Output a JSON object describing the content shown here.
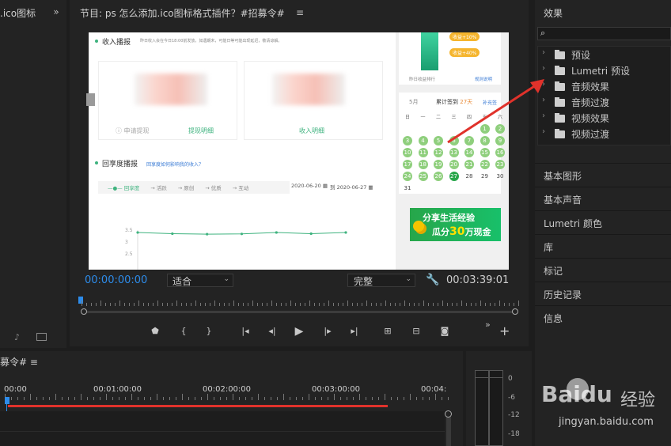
{
  "left_panel": {
    "tab_label": ".ico图标",
    "expand_icon": "double-chevron-right"
  },
  "program_monitor": {
    "title": "节目: ps 怎么添加.ico图标格式插件？#招募令#",
    "menu_icon": "hamburger",
    "timecode_current": "00:00:00:00",
    "zoom_select": "适合",
    "quality_select": "完整",
    "timecode_total": "00:03:39:01",
    "controls": [
      "marker-icon",
      "in-point-icon",
      "out-point-icon",
      "go-to-in-icon",
      "step-back-icon",
      "play-icon",
      "step-forward-icon",
      "go-to-out-icon",
      "lift-icon",
      "extract-icon",
      "export-frame-icon"
    ]
  },
  "video_frame": {
    "income_heading": "收入播报",
    "income_note": "昨日收入会在今日18:00前发放，如遇期末，可能日等可能出现延迟，敬请谅解。",
    "withdraw_link": "申请提现",
    "withdraw_detail": "提现明细",
    "income_detail": "收入明细",
    "engagement_heading": "回享度播报",
    "engagement_link": "回享度如何影响我的收入？",
    "chart_tabs": [
      "回享度",
      "活跃",
      "原创",
      "优质",
      "互动"
    ],
    "date_from": "2020-06-20",
    "date_to_prefix": "到",
    "date_to": "2020-06-27",
    "chart_y_ticks": [
      "3.5",
      "3",
      "2.5"
    ],
    "badges": [
      "收益+10%",
      "收益+40%"
    ],
    "yesterday_label": "昨日收益排行",
    "rule_label": "规则说明",
    "month_label": "5月",
    "checkin_label": "累计签到",
    "checkin_days": "27天",
    "collect_label": "补充签",
    "weekdays": [
      "日",
      "一",
      "二",
      "三",
      "四",
      "五",
      "六"
    ],
    "calendar_days": [
      "",
      "",
      "",
      "",
      "",
      "1",
      "2",
      "3",
      "4",
      "5",
      "6",
      "7",
      "8",
      "9",
      "10",
      "11",
      "12",
      "13",
      "14",
      "15",
      "16",
      "17",
      "18",
      "19",
      "20",
      "21",
      "22",
      "23",
      "24",
      "25",
      "26",
      "27",
      "28",
      "29",
      "30",
      "31"
    ],
    "banner_line1": "分享生活经验",
    "banner_line2_prefix": "瓜分",
    "banner_amount": "30",
    "banner_line2_suffix": "万现金",
    "chart_data": {
      "type": "line",
      "x": [
        1,
        2,
        3,
        4,
        5,
        6,
        7
      ],
      "values": [
        3.4,
        3.35,
        3.33,
        3.34,
        3.4,
        3.35,
        3.4
      ],
      "ylim": [
        2.5,
        3.5
      ],
      "y_ticks": [
        "3.5",
        "3",
        "2.5"
      ]
    }
  },
  "effects_panel": {
    "title": "效果",
    "search_icon": "search",
    "items": [
      {
        "label": "预设",
        "icon": "star-folder"
      },
      {
        "label": "Lumetri 预设",
        "icon": "star-folder"
      },
      {
        "label": "音频效果",
        "icon": "folder"
      },
      {
        "label": "音频过渡",
        "icon": "folder"
      },
      {
        "label": "视频效果",
        "icon": "folder"
      },
      {
        "label": "视频过渡",
        "icon": "folder"
      }
    ],
    "sections": [
      "基本图形",
      "基本声音",
      "Lumetri 颜色",
      "库",
      "标记",
      "历史记录",
      "信息"
    ]
  },
  "timeline": {
    "tab_label": "募令#",
    "ruler": [
      "00:00",
      "00:01:00:00",
      "00:02:00:00",
      "00:03:00:00",
      "00:04:"
    ]
  },
  "audio_meter": {
    "scale": [
      "0",
      "-6",
      "-12",
      "-18"
    ]
  },
  "watermark": {
    "brand": "Baidu",
    "cn": "经验",
    "url": "jingyan.baidu.com"
  },
  "colors": {
    "accent_blue": "#2d8ceb",
    "green": "#3fb37f",
    "red": "#e0322b"
  }
}
